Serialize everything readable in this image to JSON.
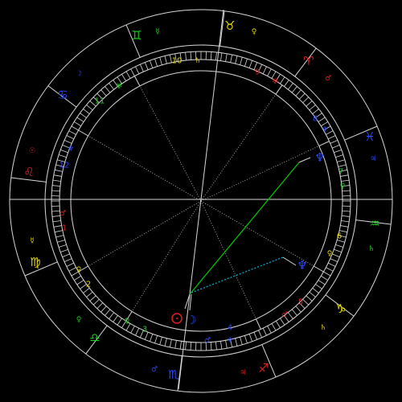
{
  "colors": {
    "background": "#000000",
    "lines": "#d8d8d8",
    "dotted": "#c8c8c8",
    "aspect_green": "#00cc00",
    "aspect_cyan": "#00b4d8",
    "fire": "#e02020",
    "earth": "#e8d800",
    "air": "#18d018",
    "water": "#2a48ff"
  },
  "zodiac": [
    {
      "name": "aries",
      "glyph": "♈",
      "color": "#e02020"
    },
    {
      "name": "taurus",
      "glyph": "♉",
      "color": "#e8d800"
    },
    {
      "name": "gemini",
      "glyph": "♊",
      "color": "#18d018"
    },
    {
      "name": "cancer",
      "glyph": "♋",
      "color": "#2a48ff"
    },
    {
      "name": "leo",
      "glyph": "♌",
      "color": "#e02020"
    },
    {
      "name": "virgo",
      "glyph": "♍",
      "color": "#e8d800"
    },
    {
      "name": "libra",
      "glyph": "♎",
      "color": "#18d018"
    },
    {
      "name": "scorpio",
      "glyph": "♏",
      "color": "#2a48ff"
    },
    {
      "name": "sagittarius",
      "glyph": "♐",
      "color": "#e02020"
    },
    {
      "name": "capricorn",
      "glyph": "♑",
      "color": "#e8d800"
    },
    {
      "name": "aquarius",
      "glyph": "♒",
      "color": "#18d018"
    },
    {
      "name": "pisces",
      "glyph": "♓",
      "color": "#2a48ff"
    }
  ],
  "rulers": [
    {
      "sign": "aries",
      "glyph": "♂",
      "color": "#e02020"
    },
    {
      "sign": "taurus",
      "glyph": "♀",
      "color": "#e8d800"
    },
    {
      "sign": "gemini",
      "glyph": "☿",
      "color": "#18d018"
    },
    {
      "sign": "cancer",
      "glyph": "☽",
      "color": "#2a48ff"
    },
    {
      "sign": "leo",
      "glyph": "☉",
      "color": "#e02020"
    },
    {
      "sign": "virgo",
      "glyph": "☿",
      "color": "#e8d800"
    },
    {
      "sign": "libra",
      "glyph": "♀",
      "color": "#18d018"
    },
    {
      "sign": "scorpio",
      "glyph": "♂",
      "color": "#2a48ff"
    },
    {
      "sign": "sagittarius",
      "glyph": "♃",
      "color": "#e02020"
    },
    {
      "sign": "capricorn",
      "glyph": "♄",
      "color": "#e8d800"
    },
    {
      "sign": "aquarius",
      "glyph": "♄",
      "color": "#18d018"
    },
    {
      "sign": "pisces",
      "glyph": "♃",
      "color": "#2a48ff"
    }
  ],
  "houses": [
    {
      "number": "1",
      "color": "#e02020"
    },
    {
      "number": "2",
      "color": "#e8d800"
    },
    {
      "number": "3",
      "color": "#18d018"
    },
    {
      "number": "4",
      "color": "#2a48ff"
    },
    {
      "number": "5",
      "color": "#e02020"
    },
    {
      "number": "6",
      "color": "#e8d800"
    },
    {
      "number": "7",
      "color": "#18d018"
    },
    {
      "number": "8",
      "color": "#2a48ff"
    },
    {
      "number": "9",
      "color": "#e02020"
    },
    {
      "number": "10",
      "color": "#e8d800"
    },
    {
      "number": "11",
      "color": "#18d018"
    },
    {
      "number": "12",
      "color": "#2a48ff"
    }
  ],
  "house_rulers": [
    {
      "house": "1",
      "glyph": "♂",
      "color": "#e02020"
    },
    {
      "house": "2",
      "glyph": "♀",
      "color": "#e8d800"
    },
    {
      "house": "3",
      "glyph": "♀",
      "color": "#18d018"
    },
    {
      "house": "4",
      "glyph": "♂",
      "color": "#2a48ff"
    },
    {
      "house": "5",
      "glyph": "♂",
      "color": "#e02020"
    },
    {
      "house": "6",
      "glyph": "♀",
      "color": "#e8d800"
    },
    {
      "house": "7",
      "glyph": "♀",
      "color": "#18d018"
    },
    {
      "house": "8",
      "glyph": "♆",
      "color": "#2a48ff"
    },
    {
      "house": "9",
      "glyph": "♅",
      "color": "#e02020"
    },
    {
      "house": "10",
      "glyph": "♄",
      "color": "#e8d800"
    },
    {
      "house": "11",
      "glyph": "♅",
      "color": "#18d018"
    },
    {
      "house": "12",
      "glyph": "♆",
      "color": "#2a48ff"
    }
  ],
  "planets": [
    {
      "name": "sun",
      "glyph": "☉",
      "color": "#e02020"
    },
    {
      "name": "moon",
      "glyph": "☽",
      "color": "#2a48ff"
    },
    {
      "name": "neptune-upper",
      "glyph": "♆",
      "color": "#2a48ff"
    },
    {
      "name": "neptune-lower",
      "glyph": "♆",
      "color": "#2a48ff"
    }
  ]
}
